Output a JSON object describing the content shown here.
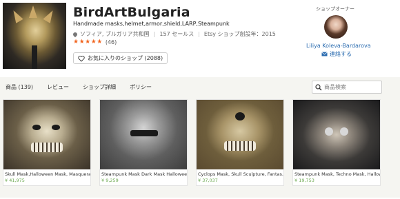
{
  "shop": {
    "name": "BirdArtBulgaria",
    "tagline": "Handmade masks,helmet,armor,shield,LARP,Steampunk",
    "location": "ソフィア, ブルガリア共和国",
    "sales": "157 セールス",
    "since": "Etsy ショップ創設年：2015",
    "stars": "★★★★★",
    "review_count": "(46)",
    "favorite_label": "お気に入りのショップ (2088)"
  },
  "owner": {
    "label": "ショップオーナー",
    "name": "Liliya Koleva-Bardarova",
    "contact": "連絡する"
  },
  "tabs": [
    "商品 (139)",
    "レビュー",
    "ショップ詳細",
    "ポリシー"
  ],
  "search": {
    "placeholder": "商品検索"
  },
  "listings": [
    {
      "title": "Skull Mask,Halloween Mask, Masquerad...",
      "price": "¥ 41,975"
    },
    {
      "title": "Steampunk Mask Dark Mask Hallowee...",
      "price": "¥ 9,259"
    },
    {
      "title": "Cyclops Mask, Skull Sculpture, Fantas...",
      "price": "¥ 37,037"
    },
    {
      "title": "Steampunk Mask, Techno Mask, Halloween...",
      "price": "¥ 19,753"
    }
  ],
  "colors": {
    "star": "#f1641e",
    "link": "#2b6cb0",
    "price": "#6aa84f",
    "tabbar_bg": "#f5f5f1"
  }
}
